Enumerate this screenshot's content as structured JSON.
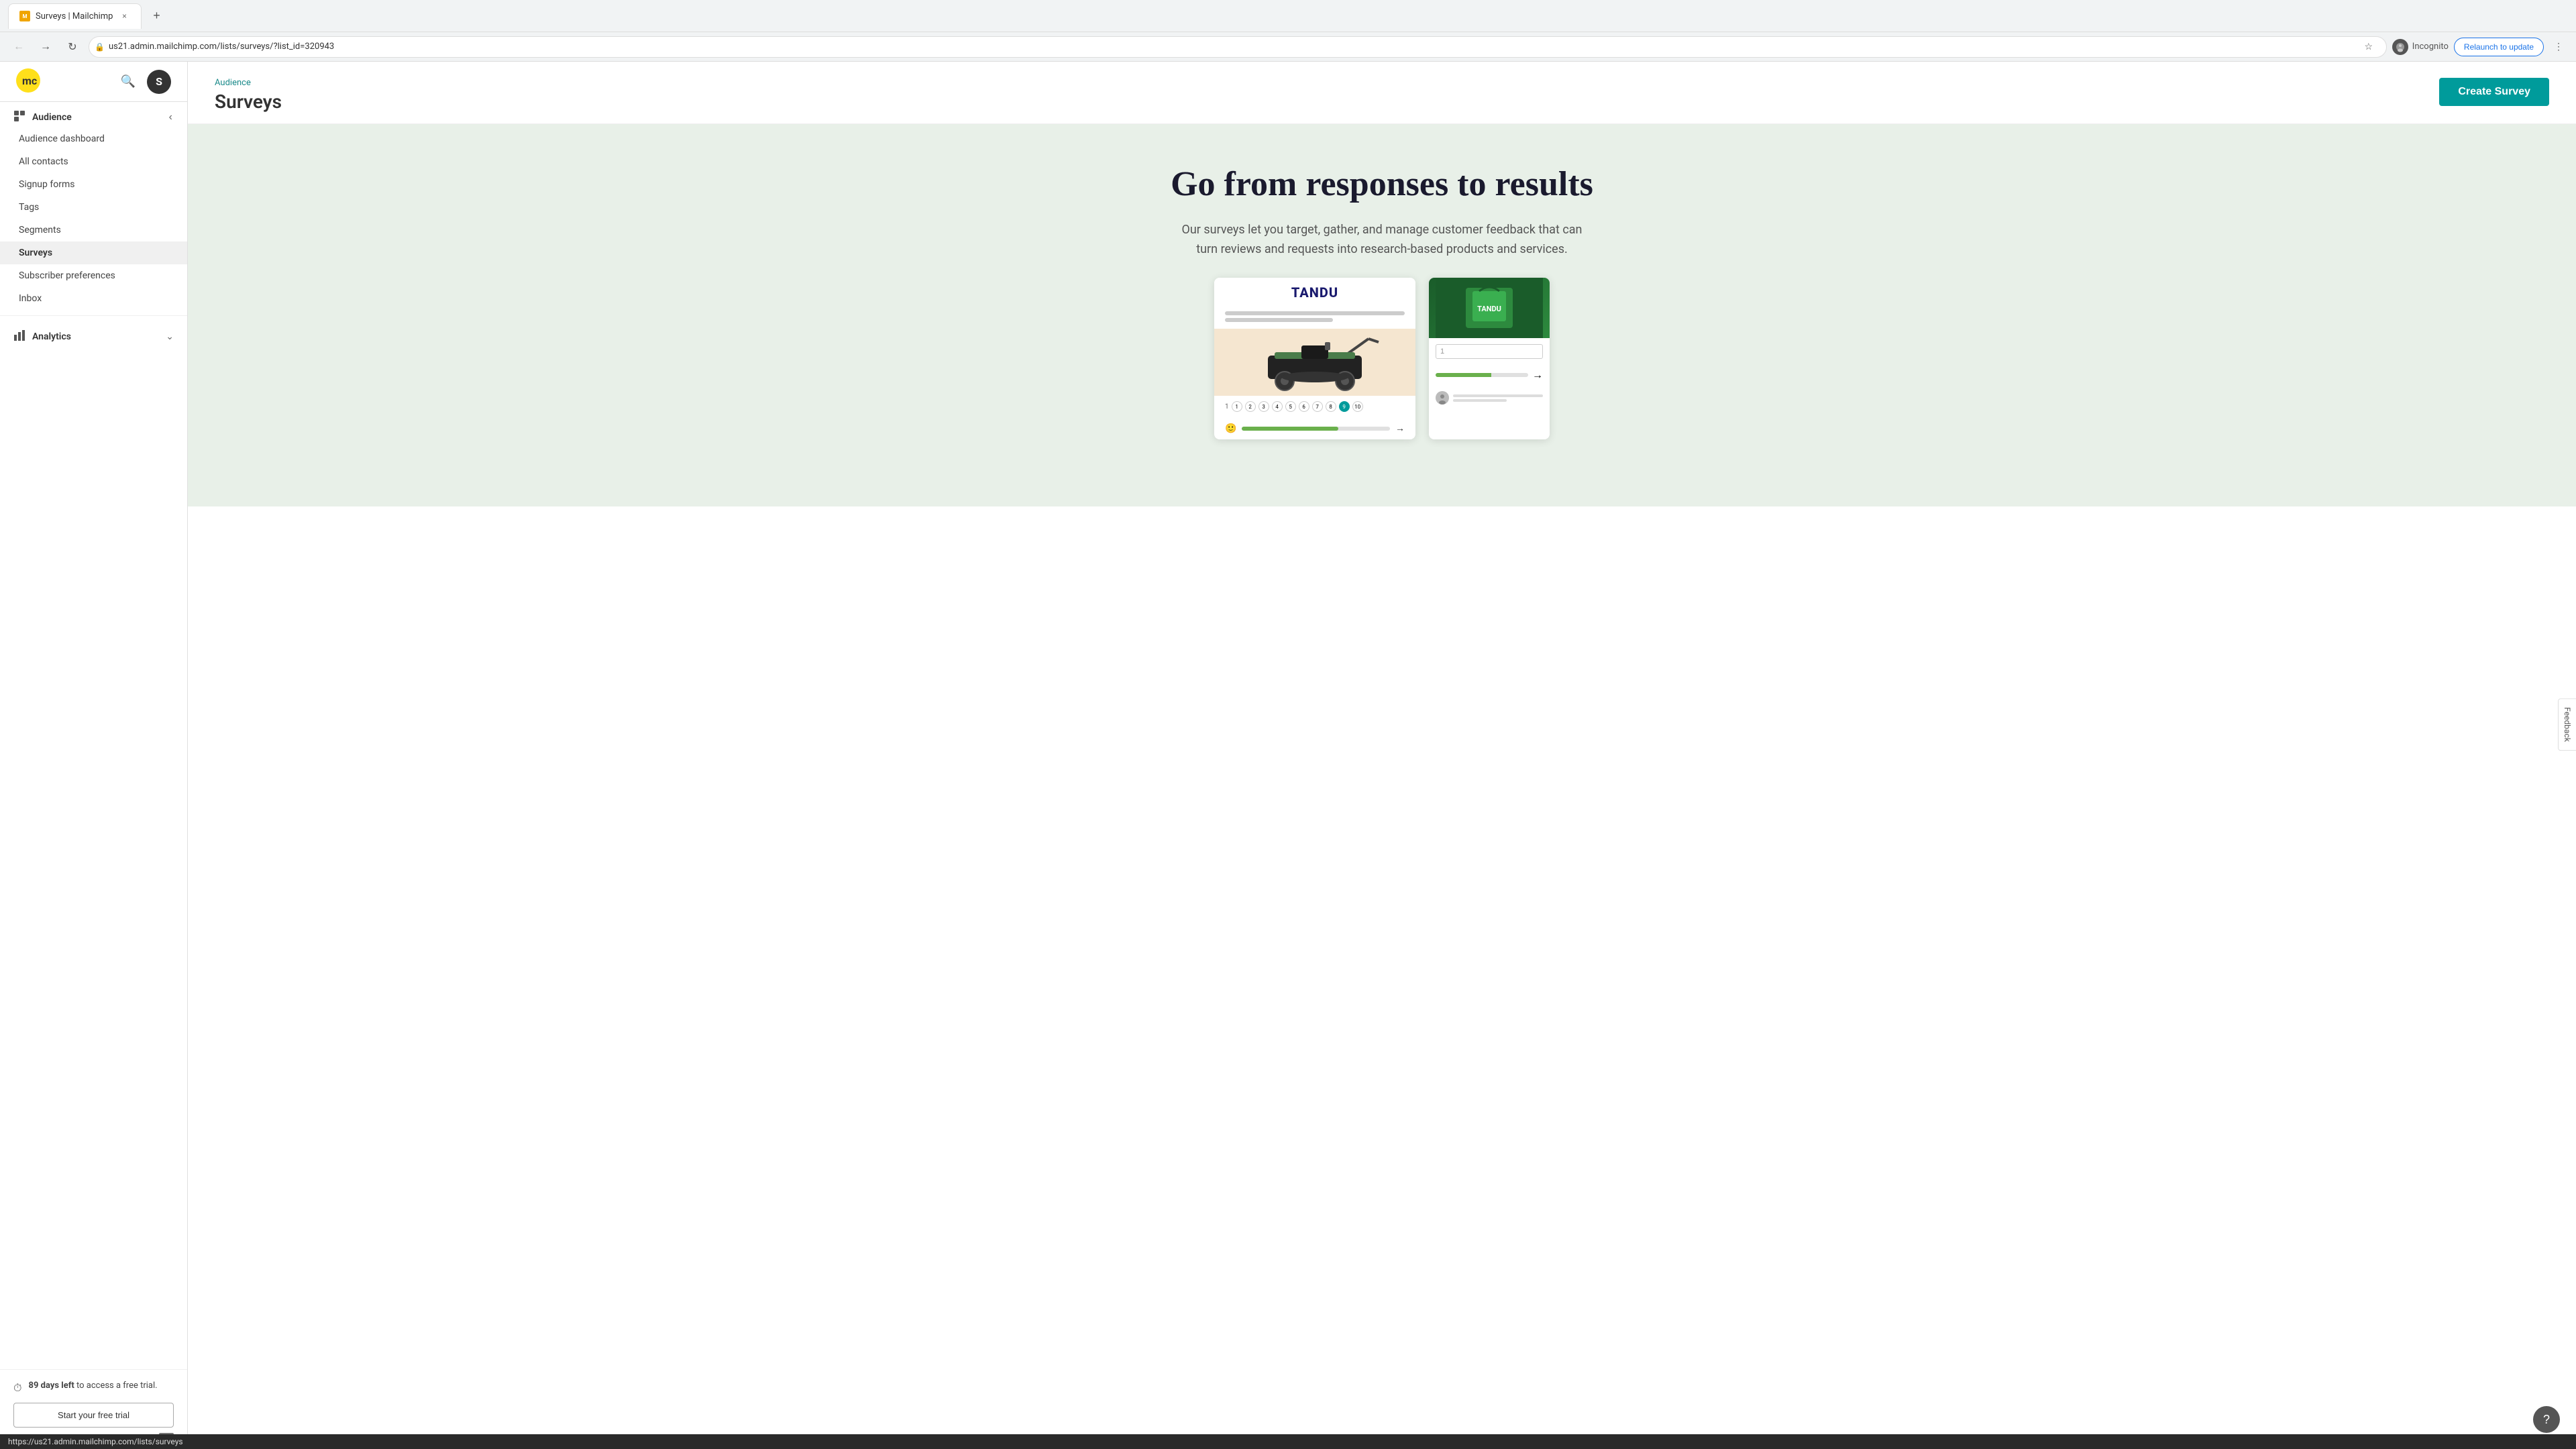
{
  "browser": {
    "tab_title": "Surveys | Mailchimp",
    "tab_close_label": "×",
    "new_tab_label": "+",
    "address_url": "us21.admin.mailchimp.com/lists/surveys/?list_id=320943",
    "incognito_label": "Incognito",
    "relaunch_label": "Relaunch to update",
    "nav_back": "‹",
    "nav_forward": "›",
    "nav_reload": "↻",
    "status_url": "https://us21.admin.mailchimp.com/lists/surveys"
  },
  "appbar": {
    "search_label": "🔍",
    "user_initial": "S"
  },
  "sidebar": {
    "section_title": "Audience",
    "collapse_icon": "⟨",
    "items": [
      {
        "label": "Audience dashboard",
        "active": false
      },
      {
        "label": "All contacts",
        "active": false
      },
      {
        "label": "Signup forms",
        "active": false
      },
      {
        "label": "Tags",
        "active": false
      },
      {
        "label": "Segments",
        "active": false
      },
      {
        "label": "Surveys",
        "active": true
      },
      {
        "label": "Subscriber preferences",
        "active": false
      },
      {
        "label": "Inbox",
        "active": false
      }
    ],
    "analytics_label": "Analytics",
    "analytics_chevron": "⌄",
    "trial_days": "89 days left",
    "trial_text": " to access a free trial.",
    "start_trial_label": "Start your free trial"
  },
  "page": {
    "breadcrumb": "Audience",
    "title": "Surveys",
    "create_btn": "Create Survey"
  },
  "hero": {
    "title": "Go from responses to results",
    "subtitle": "Our surveys let you target, gather, and manage customer feedback that can turn reviews and requests into research-based products and services."
  },
  "cards": {
    "brand_name": "TANDU",
    "small_brand": "TANDU",
    "rating_numbers": [
      "1",
      "2",
      "3",
      "4",
      "5",
      "6",
      "7",
      "8",
      "9",
      "10"
    ],
    "selected_rating": "9",
    "input_placeholder": "1",
    "next_arrow": "→"
  },
  "feedback_tab": "Feedback",
  "help_btn": "?"
}
